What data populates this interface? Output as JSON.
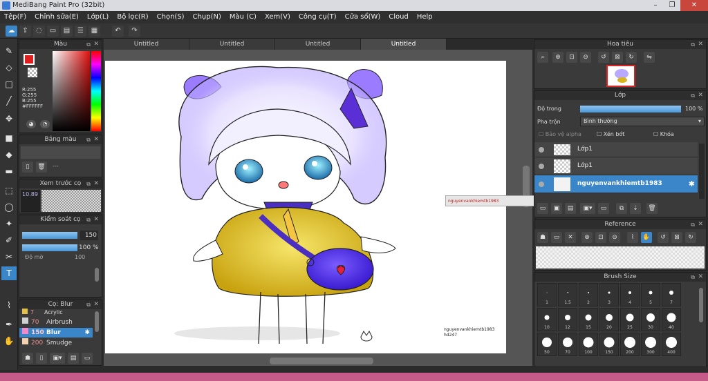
{
  "window": {
    "title": "MediBang Paint Pro (32bit)",
    "btn_min": "–",
    "btn_max": "❐",
    "btn_close": "✕"
  },
  "menu": [
    "Tệp(F)",
    "Chỉnh sửa(E)",
    "Lớp(L)",
    "Bộ lọc(R)",
    "Chọn(S)",
    "Chụp(N)",
    "Màu (C)",
    "Xem(V)",
    "Công cụ(T)",
    "Cửa sổ(W)",
    "Cloud",
    "Help"
  ],
  "toolbar": {
    "undo_icon": "↶",
    "redo_icon": "↷"
  },
  "tabs": [
    "Untitled",
    "Untitled",
    "Untitled",
    "Untitled"
  ],
  "color_panel": {
    "title": "Màu",
    "r": "R:255",
    "g": "G:255",
    "b": "B:255",
    "hex": "#FFFFFF",
    "fg": "#e02020",
    "bg": "#ffffff"
  },
  "palette_panel": {
    "title": "Bảng màu",
    "placeholder": "---"
  },
  "preview_panel": {
    "title": "Xem trước cọ",
    "size": "10.89"
  },
  "brush_control": {
    "title": "Kiểm soát cọ",
    "size": "150",
    "opacity": "100 %",
    "density_label": "Độ mờ",
    "density_value": "100"
  },
  "brush_list": {
    "title": "Cọ: Blur",
    "items": [
      {
        "size": "7",
        "name": "Acrylic",
        "color": "#e2c04a"
      },
      {
        "size": "70",
        "name": "Airbrush",
        "color": "#d0d0d0"
      },
      {
        "size": "150",
        "name": "Blur",
        "color": "#f08acb"
      },
      {
        "size": "200",
        "name": "Smudge",
        "color": "#f3d0b0"
      }
    ]
  },
  "navigator": {
    "title": "Hoa tiêu"
  },
  "layer_panel": {
    "title": "Lớp",
    "opacity_label": "Độ trong",
    "opacity_value": "100 %",
    "opacity": 1.0,
    "blend_label": "Pha trộn",
    "blend_value": "Bình thường",
    "protect_alpha": "Bảo vệ alpha",
    "clip": "Xén bớt",
    "lock": "Khóa",
    "layers": [
      {
        "name": "Lớp1"
      },
      {
        "name": "Lớp1"
      },
      {
        "name": "nguyenvankhiemtb1983"
      }
    ]
  },
  "reference_panel": {
    "title": "Reference"
  },
  "brush_size_panel": {
    "title": "Brush Size",
    "sizes": [
      "1",
      "1.5",
      "2",
      "3",
      "4",
      "5",
      "7",
      "10",
      "12",
      "15",
      "20",
      "25",
      "30",
      "40",
      "50",
      "70",
      "100",
      "150",
      "200",
      "300",
      "400"
    ]
  },
  "canvas": {
    "signature_line1": "nguyenvankhiemtb1983",
    "signature_line2": "hd247",
    "popup_text": "nguyenvankhiemtb1983"
  }
}
